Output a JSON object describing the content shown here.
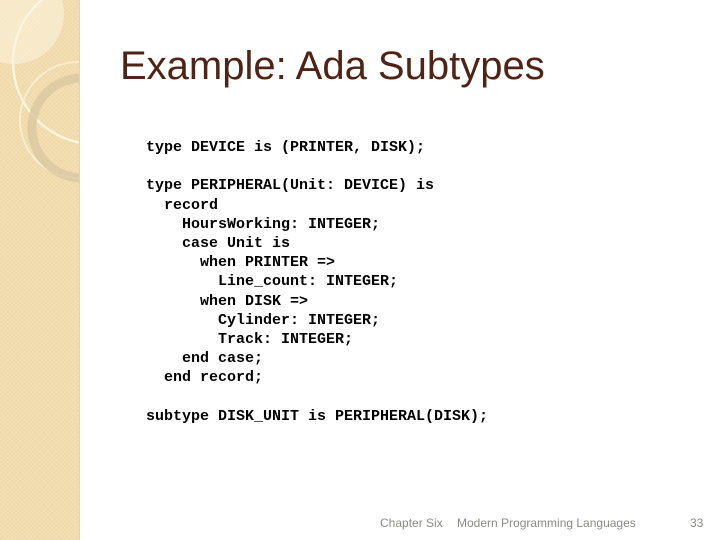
{
  "slide": {
    "title": "Example: Ada Subtypes",
    "code_lines": [
      "type DEVICE is (PRINTER, DISK);",
      "",
      "type PERIPHERAL(Unit: DEVICE) is",
      "  record",
      "    HoursWorking: INTEGER;",
      "    case Unit is",
      "      when PRINTER =>",
      "        Line_count: INTEGER;",
      "      when DISK =>",
      "        Cylinder: INTEGER;",
      "        Track: INTEGER;",
      "    end case;",
      "  end record;",
      "",
      "subtype DISK_UNIT is PERIPHERAL(DISK);"
    ]
  },
  "footer": {
    "chapter": "Chapter Six",
    "course": "Modern Programming Languages",
    "page_number": "33"
  },
  "colors": {
    "title": "#4f2417",
    "sidebar": "#f0d9a8",
    "footer_text": "#8b8b84"
  }
}
